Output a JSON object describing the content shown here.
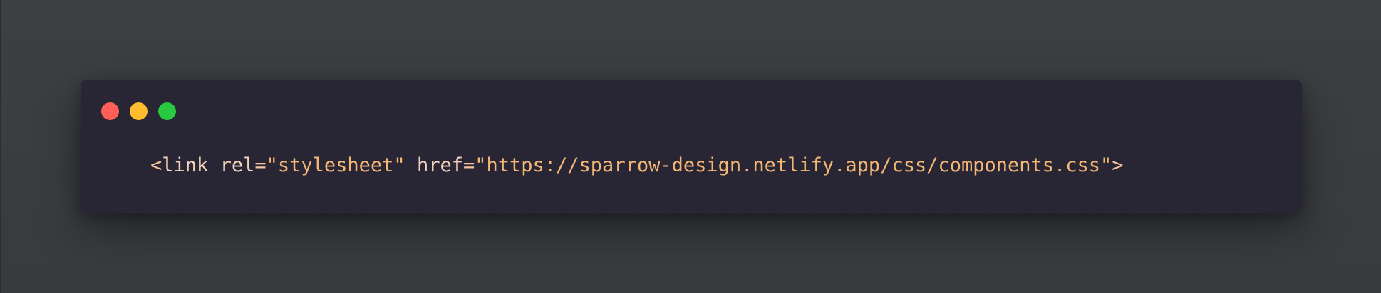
{
  "colors": {
    "background": "#3c3f42",
    "window": "#282634",
    "close": "#ff5f57",
    "minimize": "#febc2e",
    "maximize": "#28c840",
    "tag_text": "#f6d3bc",
    "string_text": "#f6b776"
  },
  "window_controls": [
    {
      "name": "close-icon",
      "color": "#ff5f57"
    },
    {
      "name": "minimize-icon",
      "color": "#febc2e"
    },
    {
      "name": "maximize-icon",
      "color": "#28c840"
    }
  ],
  "code": {
    "open_bracket": "<",
    "tag": "link",
    "space1": " ",
    "attr1_name": "rel",
    "equals1": "=",
    "attr1_value": "\"stylesheet\"",
    "space2": " ",
    "attr2_name": "href",
    "equals2": "=",
    "attr2_value": "\"https://sparrow-design.netlify.app/css/components.css\"",
    "close_bracket": ">"
  }
}
